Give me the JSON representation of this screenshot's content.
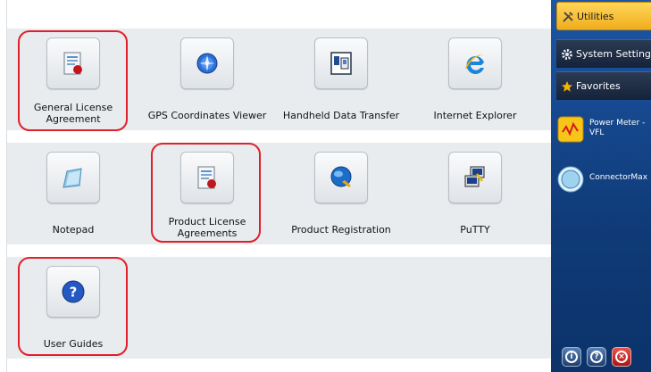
{
  "apps": [
    {
      "label": "General License\nAgreement",
      "icon": "license-document-icon"
    },
    {
      "label": "GPS Coordinates Viewer",
      "icon": "gps-globe-icon"
    },
    {
      "label": "Handheld Data Transfer",
      "icon": "handheld-transfer-icon"
    },
    {
      "label": "Internet Explorer",
      "icon": "internet-explorer-icon"
    },
    {
      "label": "Notepad",
      "icon": "notepad-icon"
    },
    {
      "label": "Product License\nAgreements",
      "icon": "license-document-icon"
    },
    {
      "label": "Product Registration",
      "icon": "registration-globe-icon"
    },
    {
      "label": "PuTTY",
      "icon": "putty-icon"
    },
    {
      "label": "User Guides",
      "icon": "help-icon"
    }
  ],
  "side": {
    "tabs": [
      {
        "label": "Utilities",
        "icon": "tools-icon",
        "active": true
      },
      {
        "label": "System Settings",
        "icon": "gear-icon",
        "active": false
      },
      {
        "label": "Favorites",
        "icon": "star-icon",
        "active": false
      }
    ],
    "pinned": [
      {
        "label_line1": "Power Meter -",
        "label_line2": "VFL",
        "icon": "power-meter-icon"
      },
      {
        "label_line1": "ConnectorMax",
        "label_line2": "",
        "icon": "connector-max-icon"
      }
    ],
    "bottom_buttons": [
      {
        "icon": "info-icon",
        "glyph": "i"
      },
      {
        "icon": "help-icon",
        "glyph": "?"
      },
      {
        "icon": "close-icon",
        "glyph": "×"
      }
    ]
  },
  "colors": {
    "accent": "#f0ad1c",
    "highlight": "#e0202a",
    "panel_blue": "#1d56a6"
  }
}
